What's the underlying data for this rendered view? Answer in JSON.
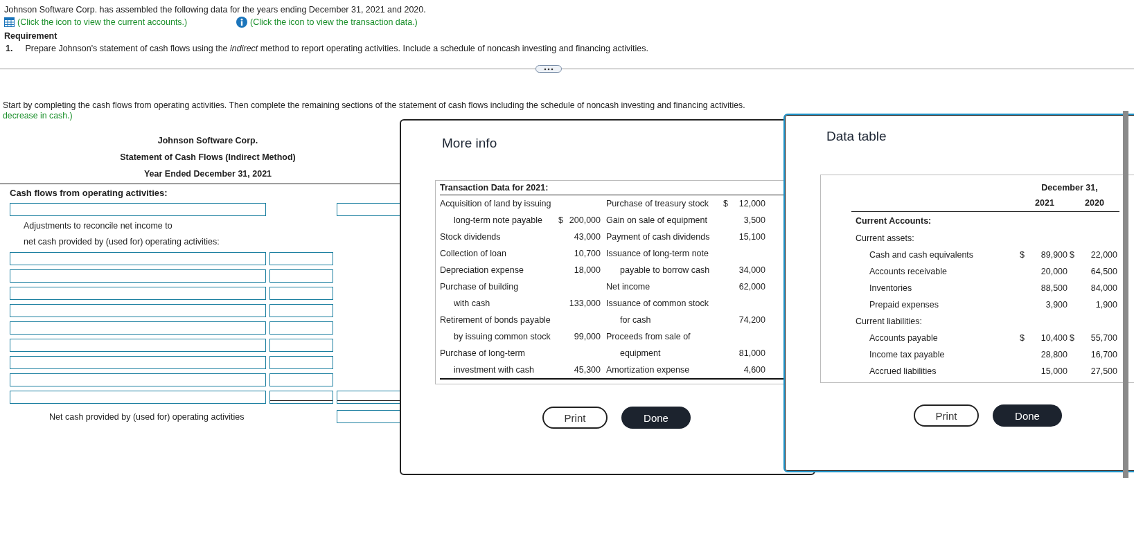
{
  "intro": {
    "text": "Johnson Software Corp. has assembled the following data for the years ending December 31, 2021 and 2020.",
    "links": [
      {
        "kind": "table",
        "text": "(Click the icon to view the current accounts.)"
      },
      {
        "kind": "info",
        "text": "(Click the icon to view the transaction data.)"
      }
    ]
  },
  "requirement": {
    "heading": "Requirement",
    "number": "1.",
    "text": "Prepare Johnson's statement of cash flows using the *indirect* method to report operating activities. Include a schedule of noncash investing and financing activities."
  },
  "instruction": {
    "text": "Start by completing the cash flows from operating activities. Then complete the remaining sections of the statement of cash flows including the schedule of noncash investing and financing activities.",
    "hint": "decrease in cash.)"
  },
  "statement": {
    "title_lines": [
      "Johnson Software Corp.",
      "Statement of Cash Flows (Indirect Method)",
      "Year Ended December 31, 2021"
    ],
    "rows": [
      {
        "kind": "heading",
        "text": "Cash flows from operating activities:"
      },
      {
        "kind": "entry"
      },
      {
        "kind": "note",
        "text": "Adjustments to reconcile net income to"
      },
      {
        "kind": "note",
        "text": "net cash provided by (used for) operating activities:"
      },
      {
        "kind": "adjustment"
      },
      {
        "kind": "adjustment"
      },
      {
        "kind": "adjustment"
      },
      {
        "kind": "adjustment"
      },
      {
        "kind": "adjustment"
      },
      {
        "kind": "adjustment"
      },
      {
        "kind": "adjustment"
      },
      {
        "kind": "adjustment"
      },
      {
        "kind": "subtotal"
      },
      {
        "kind": "total",
        "text": "Net cash provided by (used for) operating activities"
      }
    ]
  },
  "more_info": {
    "title": "More info",
    "table_title": "Transaction Data for 2021:",
    "rows": [
      {
        "left": {
          "label": "Acquisition of land by issuing",
          "indented": false
        },
        "right": {
          "label": "Purchase of treasury stock",
          "indented": false,
          "currency": "$",
          "value": "12,000"
        }
      },
      {
        "left": {
          "label": "long-term note payable",
          "indented": true,
          "currency": "$",
          "value": "200,000"
        },
        "right": {
          "label": "Gain on sale of equipment",
          "indented": false,
          "value": "3,500"
        }
      },
      {
        "left": {
          "label": "Stock dividends",
          "indented": false,
          "value": "43,000"
        },
        "right": {
          "label": "Payment of cash dividends",
          "indented": false,
          "value": "15,100"
        }
      },
      {
        "left": {
          "label": "Collection of loan",
          "indented": false,
          "value": "10,700"
        },
        "right": {
          "label": "Issuance of long-term note",
          "indented": false
        }
      },
      {
        "left": {
          "label": "Depreciation expense",
          "indented": false,
          "value": "18,000"
        },
        "right": {
          "label": "payable to borrow cash",
          "indented": true,
          "value": "34,000"
        }
      },
      {
        "left": {
          "label": "Purchase of building",
          "indented": false
        },
        "right": {
          "label": "Net income",
          "indented": false,
          "value": "62,000"
        }
      },
      {
        "left": {
          "label": "with cash",
          "indented": true,
          "value": "133,000"
        },
        "right": {
          "label": "Issuance of common stock",
          "indented": false
        }
      },
      {
        "left": {
          "label": "Retirement of bonds payable",
          "indented": false
        },
        "right": {
          "label": "for cash",
          "indented": true,
          "value": "74,200"
        }
      },
      {
        "left": {
          "label": "by issuing common stock",
          "indented": true,
          "value": "99,000"
        },
        "right": {
          "label": "Proceeds from sale of",
          "indented": false
        }
      },
      {
        "left": {
          "label": "Purchase of long-term",
          "indented": false
        },
        "right": {
          "label": "equipment",
          "indented": true,
          "value": "81,000"
        }
      },
      {
        "left": {
          "label": "investment with cash",
          "indented": true,
          "value": "45,300"
        },
        "right": {
          "label": "Amortization expense",
          "indented": false,
          "value": "4,600"
        }
      }
    ],
    "buttons": [
      {
        "kind": "secondary",
        "label": "Print"
      },
      {
        "kind": "primary",
        "label": "Done"
      }
    ]
  },
  "data_table": {
    "title": "Data table",
    "header": "December 31,",
    "years": [
      "2021",
      "2020"
    ],
    "rows": [
      {
        "kind": "section",
        "label": "Current Accounts:"
      },
      {
        "kind": "group",
        "label": "Current assets:"
      },
      {
        "kind": "item",
        "label": "Cash and cash equivalents",
        "values": [
          {
            "currency": "$",
            "value": "89,900"
          },
          {
            "currency": "$",
            "value": "22,000"
          }
        ]
      },
      {
        "kind": "item",
        "label": "Accounts receivable",
        "values": [
          {
            "value": "20,000"
          },
          {
            "value": "64,500"
          }
        ]
      },
      {
        "kind": "item",
        "label": "Inventories",
        "values": [
          {
            "value": "88,500"
          },
          {
            "value": "84,000"
          }
        ]
      },
      {
        "kind": "item",
        "label": "Prepaid expenses",
        "values": [
          {
            "value": "3,900"
          },
          {
            "value": "1,900"
          }
        ]
      },
      {
        "kind": "group",
        "label": "Current liabilities:"
      },
      {
        "kind": "item",
        "label": "Accounts payable",
        "values": [
          {
            "currency": "$",
            "value": "10,400"
          },
          {
            "currency": "$",
            "value": "55,700"
          }
        ]
      },
      {
        "kind": "item",
        "label": "Income tax payable",
        "values": [
          {
            "value": "28,800"
          },
          {
            "value": "16,700"
          }
        ]
      },
      {
        "kind": "item",
        "label": "Accrued liabilities",
        "values": [
          {
            "value": "15,000"
          },
          {
            "value": "27,500"
          }
        ]
      }
    ],
    "buttons": [
      {
        "kind": "secondary",
        "label": "Print"
      },
      {
        "kind": "primary",
        "label": "Done"
      }
    ]
  }
}
